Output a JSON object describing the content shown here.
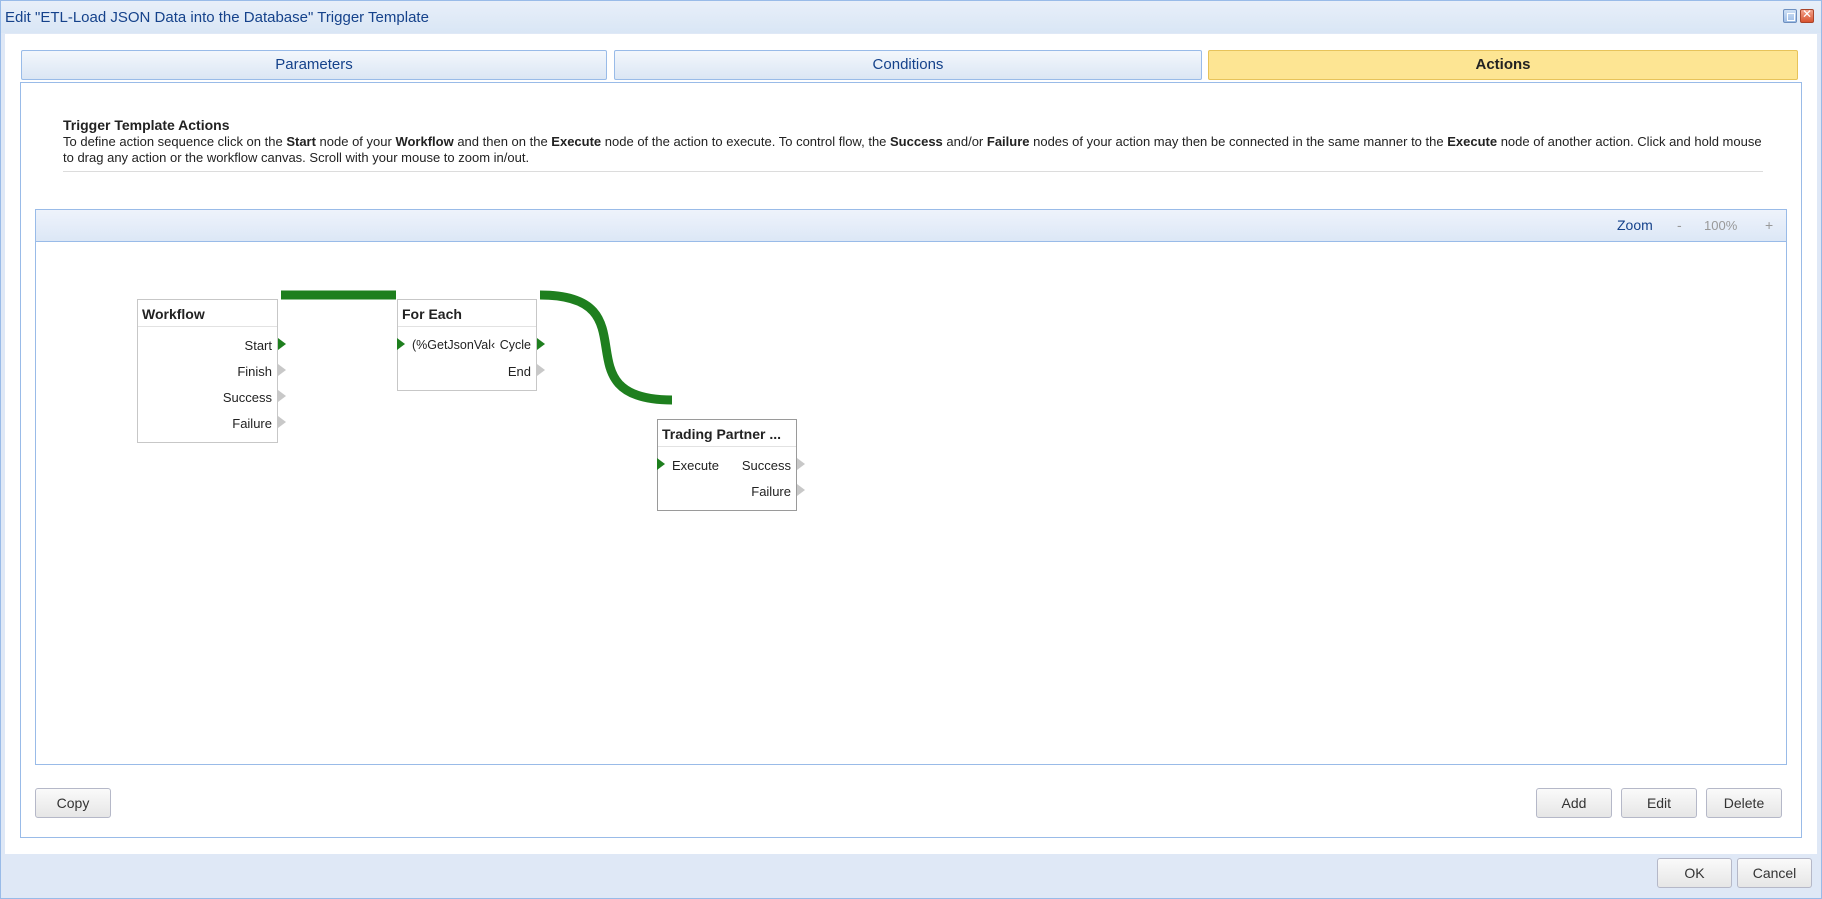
{
  "window": {
    "title": "Edit \"ETL-Load JSON Data into the Database\" Trigger Template",
    "restore_icon": "restore-icon",
    "close_icon": "close-icon"
  },
  "tabs": [
    {
      "label": "Parameters",
      "active": false
    },
    {
      "label": "Conditions",
      "active": false
    },
    {
      "label": "Actions",
      "active": true
    }
  ],
  "description": {
    "title": "Trigger Template Actions",
    "segments": [
      {
        "text": "To define action sequence click on the ",
        "bold": false
      },
      {
        "text": "Start",
        "bold": true
      },
      {
        "text": " node of your ",
        "bold": false
      },
      {
        "text": "Workflow",
        "bold": true
      },
      {
        "text": " and then on the ",
        "bold": false
      },
      {
        "text": "Execute",
        "bold": true
      },
      {
        "text": " node of the action to execute. To control flow, the ",
        "bold": false
      },
      {
        "text": "Success",
        "bold": true
      },
      {
        "text": " and/or ",
        "bold": false
      },
      {
        "text": "Failure",
        "bold": true
      },
      {
        "text": " nodes of your action may then be connected in the same manner to the ",
        "bold": false
      },
      {
        "text": "Execute",
        "bold": true
      },
      {
        "text": " node of another action. Click and hold mouse to drag any action or the workflow canvas. Scroll with your mouse to zoom in/out.",
        "bold": false
      }
    ]
  },
  "zoom": {
    "label": "Zoom",
    "minus": "-",
    "value": "100%",
    "plus": "+"
  },
  "nodes": {
    "workflow": {
      "title": "Workflow",
      "outputs": [
        "Start",
        "Finish",
        "Success",
        "Failure"
      ]
    },
    "for_each": {
      "title": "For Each",
      "input": "(%GetJsonVal‹",
      "outputs": [
        "Cycle",
        "End"
      ]
    },
    "trading_partner": {
      "title": "Trading Partner ...",
      "input": "Execute",
      "outputs": [
        "Success",
        "Failure"
      ]
    }
  },
  "connections": [
    {
      "from": "Workflow.Start",
      "to": "For Each.input",
      "color": "#1e7f1e"
    },
    {
      "from": "For Each.Cycle",
      "to": "Trading Partner.Execute",
      "color": "#1e7f1e"
    }
  ],
  "buttons": {
    "copy": "Copy",
    "add": "Add",
    "edit": "Edit",
    "delete": "Delete",
    "ok": "OK",
    "cancel": "Cancel"
  },
  "colors": {
    "active_tab": "#fde593",
    "connector": "#1e7f1e",
    "title_text": "#15428b"
  }
}
